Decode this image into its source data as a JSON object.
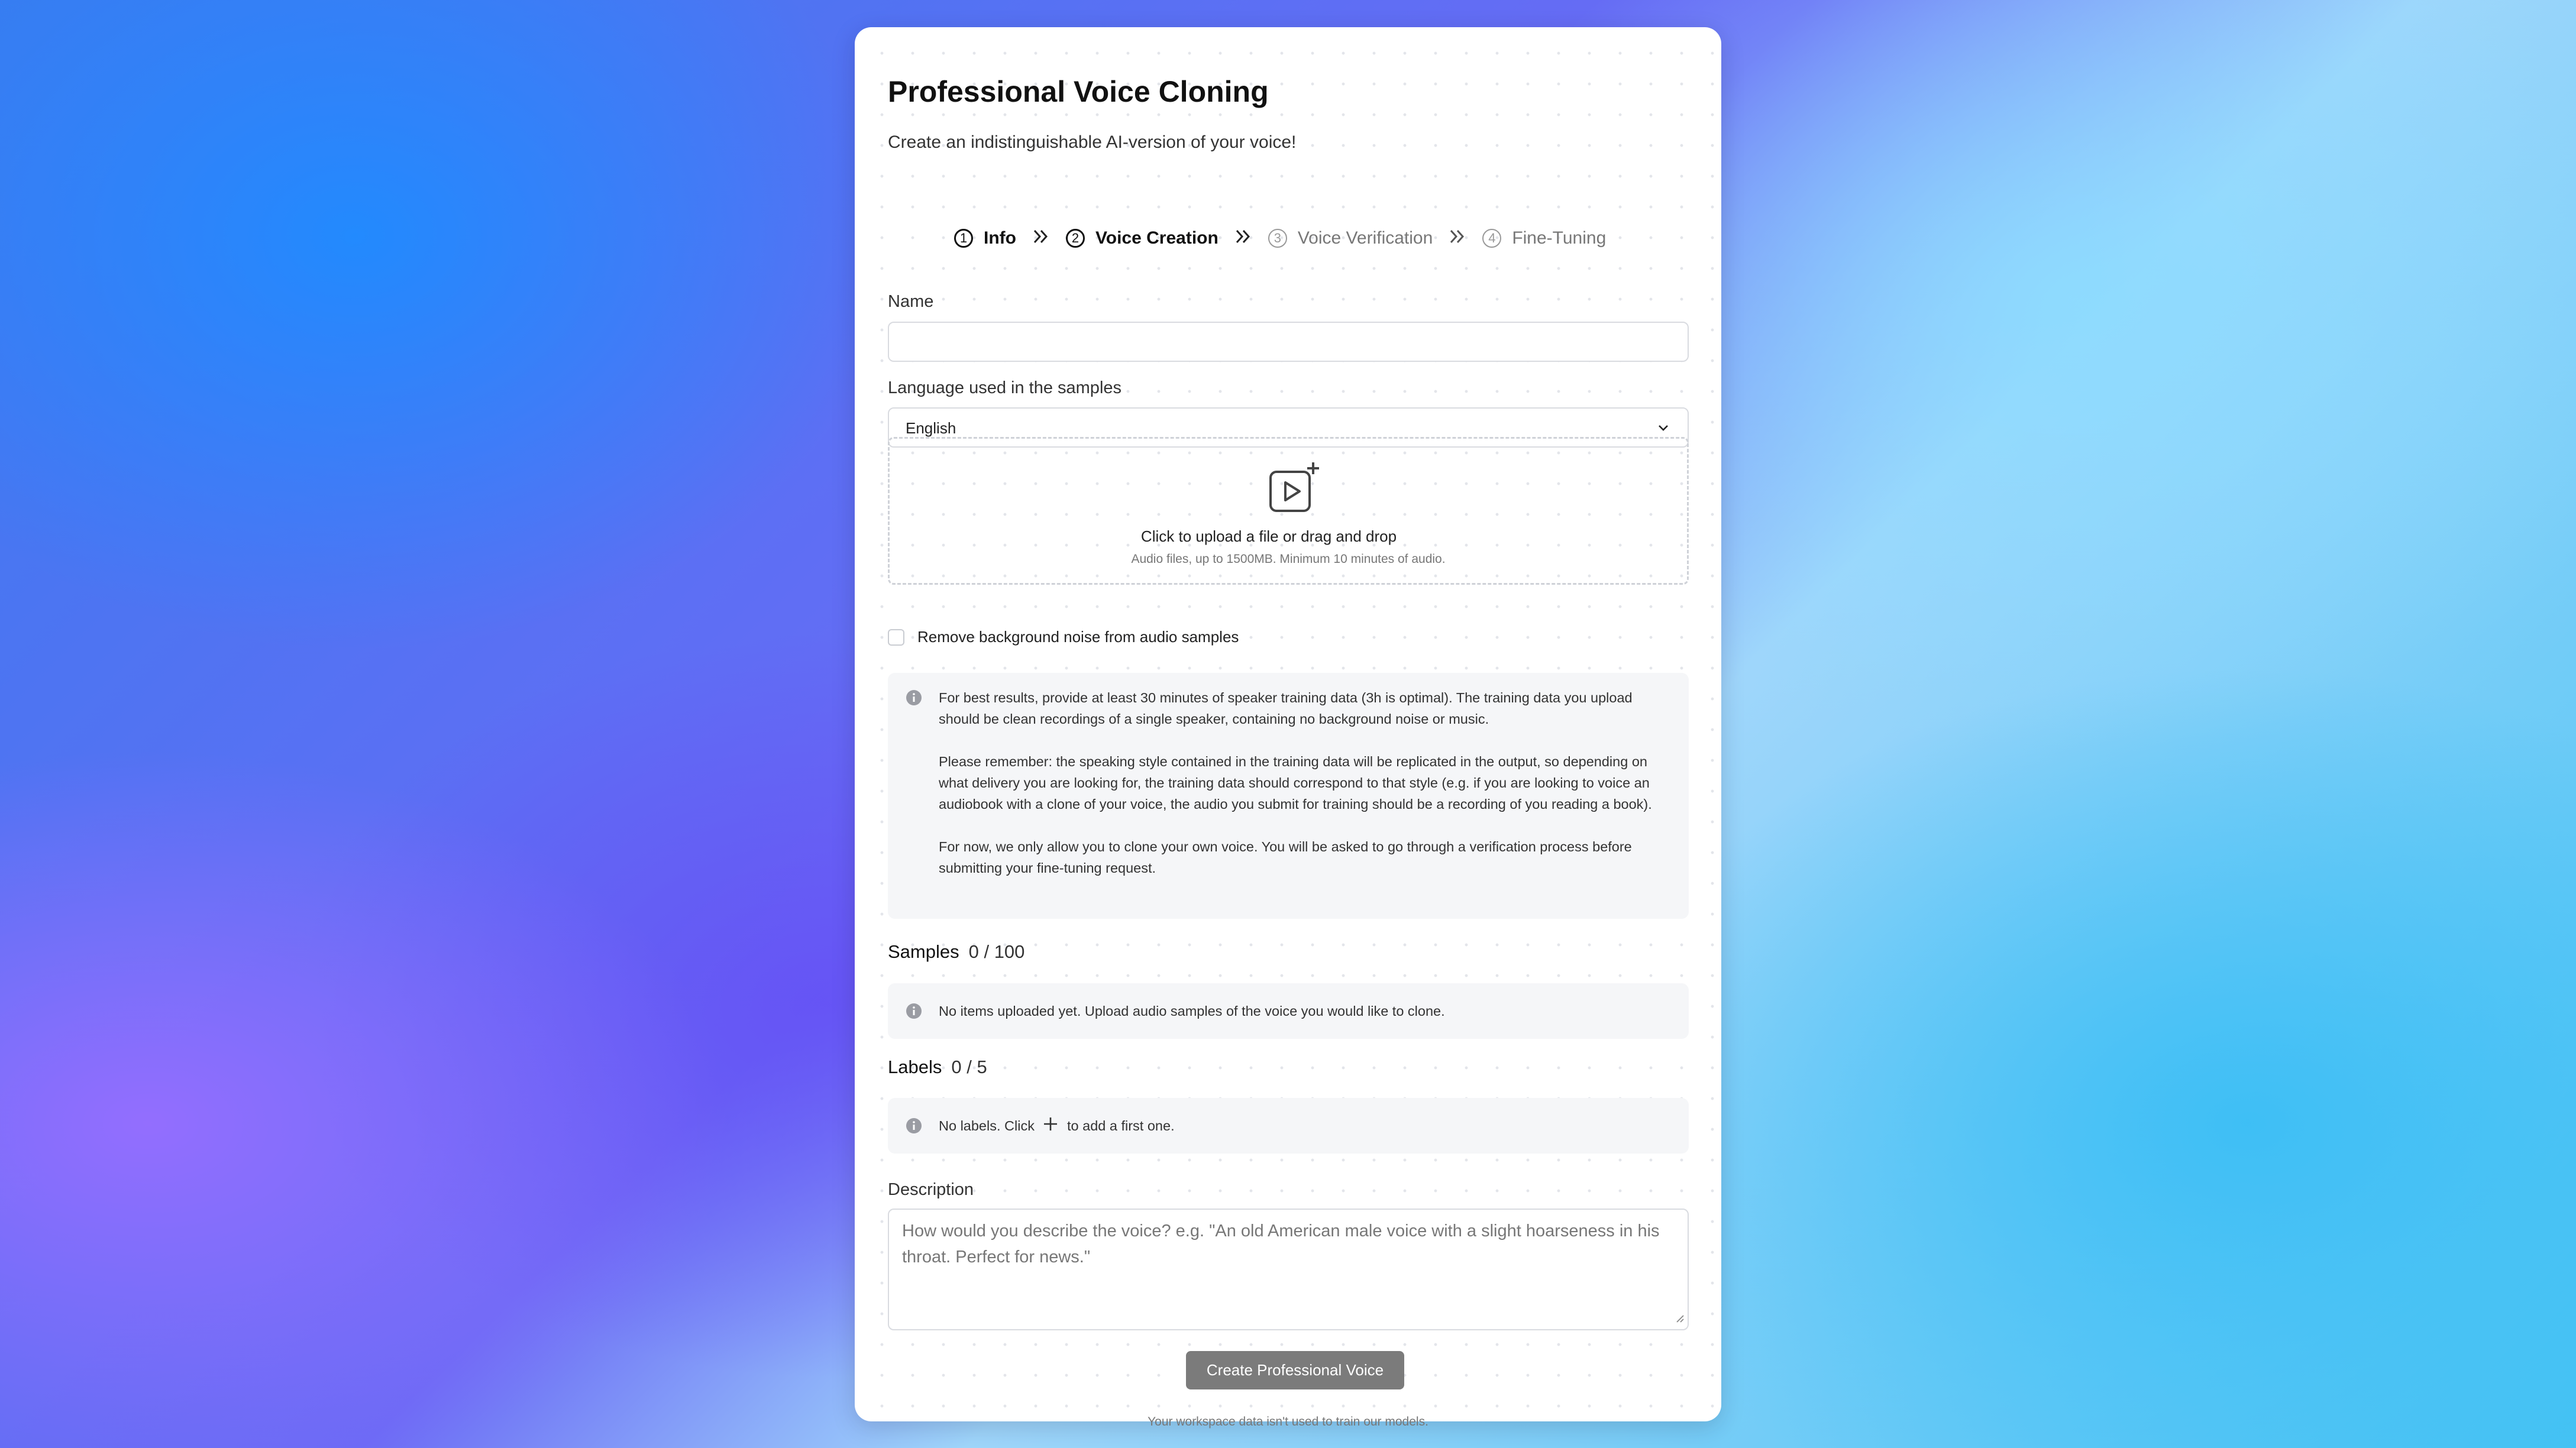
{
  "page": {
    "title": "Professional Voice Cloning",
    "subtitle": "Create an indistinguishable AI-version of your voice!"
  },
  "stepper": [
    {
      "number": "1",
      "label": "Info",
      "state": "done"
    },
    {
      "number": "2",
      "label": "Voice Creation",
      "state": "active"
    },
    {
      "number": "3",
      "label": "Voice Verification",
      "state": "pending"
    },
    {
      "number": "4",
      "label": "Fine-Tuning",
      "state": "pending"
    }
  ],
  "form": {
    "name_label": "Name",
    "name_value": "",
    "language_label": "Language used in the samples",
    "language_value": "English",
    "upload_title": "Click to upload a file or drag and drop",
    "upload_subtitle": "Audio files, up to 1500MB. Minimum 10 minutes of audio.",
    "noise_checkbox_label": "Remove background noise from audio samples",
    "noise_checkbox_checked": false
  },
  "info": {
    "paragraph1": "For best results, provide at least 30 minutes of speaker training data (3h is optimal). The training data you upload should be clean recordings of a single speaker, containing no background noise or music.",
    "paragraph2": "Please remember: the speaking style contained in the training data will be replicated in the output, so depending on what delivery you are looking for, the training data should correspond to that style (e.g. if you are looking to voice an audiobook with a clone of your voice, the audio you submit for training should be a recording of you reading a book).",
    "paragraph3": "For now, we only allow you to clone your own voice. You will be asked to go through a verification process before submitting your fine-tuning request."
  },
  "samples": {
    "title": "Samples",
    "count": "0 / 100",
    "empty_text": "No items uploaded yet. Upload audio samples of the voice you would like to clone."
  },
  "labels": {
    "title": "Labels",
    "count": "0 / 5",
    "empty_before": "No labels. Click",
    "empty_after": "to add a first one."
  },
  "description": {
    "label": "Description",
    "placeholder": "How would you describe the voice? e.g. \"An old American male voice with a slight hoarseness in his throat. Perfect for news.\""
  },
  "actions": {
    "create_label": "Create Professional Voice"
  },
  "footer": {
    "note": "Your workspace data isn't used to train our models."
  },
  "icons": {
    "info": "info-circle-icon",
    "upload": "video-add-icon",
    "chevron": "chevron-down-icon",
    "separator": "double-chevron-right-icon",
    "plus": "plus-icon"
  }
}
